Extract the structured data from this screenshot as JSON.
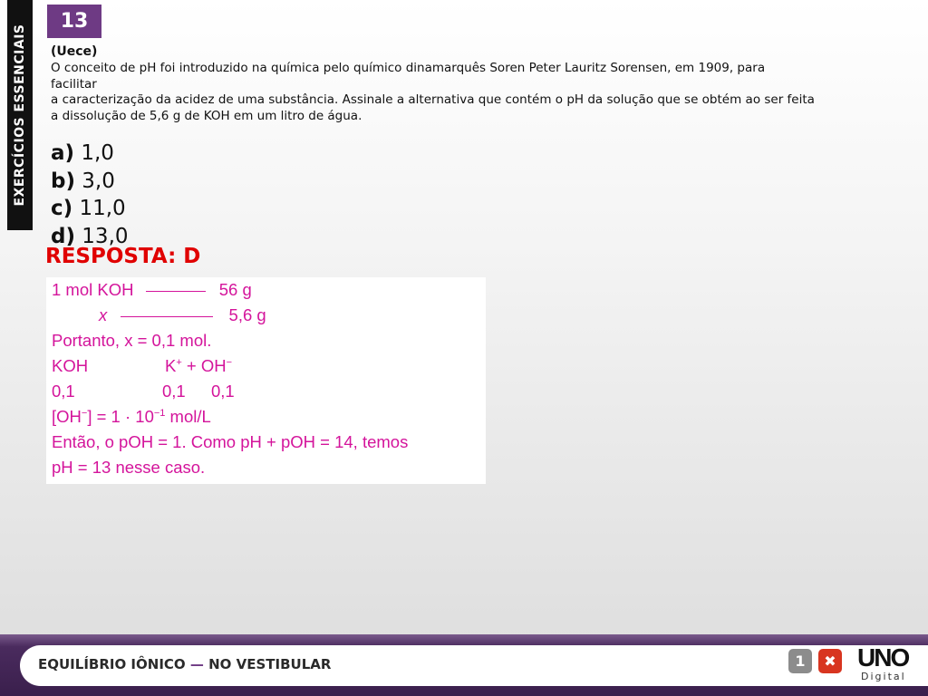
{
  "sidebar": {
    "label": "EXERCÍCIOS ESSENCIAIS"
  },
  "question": {
    "number": "13",
    "source": "(Uece)",
    "lines": [
      "O conceito de pH foi introduzido na química pelo químico dinamarquês Soren Peter Lauritz Sorensen, em 1909, para",
      "facilitar",
      "a caracterização da acidez de uma substância. Assinale a alternativa que contém o pH da solução que se obtém ao ser feita",
      "a dissolução de 5,6 g de KOH em um litro de água."
    ],
    "options": [
      {
        "key": "a)",
        "value": "1,0"
      },
      {
        "key": "b)",
        "value": "3,0"
      },
      {
        "key": "c)",
        "value": "11,0"
      },
      {
        "key": "d)",
        "value": "13,0"
      }
    ]
  },
  "answer": "RESPOSTA: D",
  "solution": {
    "l1a": "1 mol KOH",
    "l1b": "56 g",
    "l2a": "x",
    "l2b": "5,6 g",
    "l3": "Portanto, x = 0,1 mol.",
    "l4a": "KOH",
    "l4b": "K",
    "l4c": "+",
    "l4d": " + OH",
    "l4e": "−",
    "l5a": "0,1",
    "l5b": "0,1",
    "l5c": "0,1",
    "l6a": "[OH",
    "l6b": "−",
    "l6c": "] = 1 · 10",
    "l6d": "−1",
    "l6e": " mol/L",
    "l7": "Então, o pOH = 1. Como pH + pOH = 14, temos",
    "l8": "pH = 13 nesse caso."
  },
  "footer": {
    "title": "EQUILÍBRIO IÔNICO",
    "separator": " — ",
    "subtitle": "NO VESTIBULAR",
    "info_label": "1",
    "close_label": "✖",
    "logo_text": "UNO",
    "logo_sub": "Digital"
  },
  "colors": {
    "accent": "#6e3a84",
    "answer": "#e00000",
    "solution": "#d4149b"
  }
}
